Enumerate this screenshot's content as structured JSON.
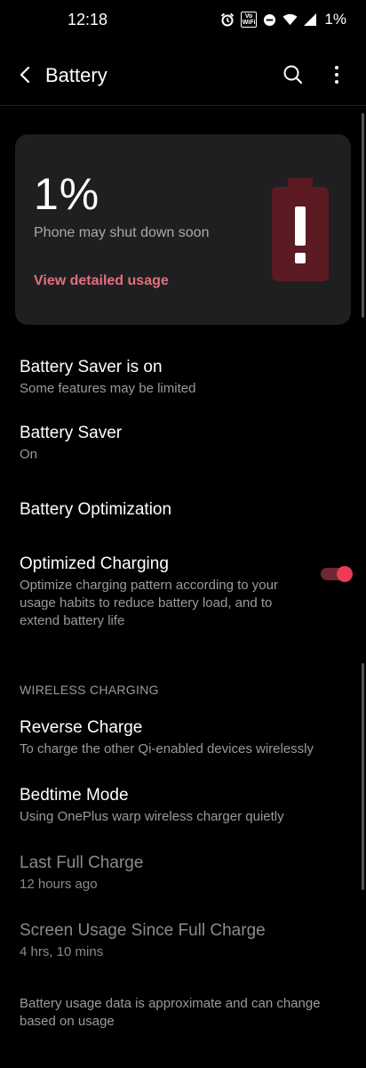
{
  "status_bar": {
    "time": "12:18",
    "volte_label": "Vo\nWiFi",
    "battery_percent": "1%",
    "icons": [
      "alarm-icon",
      "volte-wifi-icon",
      "dnd-icon",
      "wifi-icon",
      "signal-icon"
    ]
  },
  "app_bar": {
    "title": "Battery",
    "icons": [
      "back-arrow-icon",
      "search-icon",
      "more-vert-icon"
    ]
  },
  "battery_card": {
    "percent": "1%",
    "message": "Phone may shut down soon",
    "link": "View detailed usage",
    "icon": "battery-alert-icon"
  },
  "settings": [
    {
      "title": "Battery Saver is on",
      "subtitle": "Some features may be limited"
    },
    {
      "title": "Battery Saver",
      "subtitle": "On"
    },
    {
      "title": "Battery Optimization",
      "subtitle": ""
    },
    {
      "title": "Optimized Charging",
      "subtitle": "Optimize charging pattern according to your usage habits to reduce battery load, and to extend battery life",
      "toggle": true
    }
  ],
  "wireless_section": {
    "header": "WIRELESS CHARGING",
    "items": [
      {
        "title": "Reverse Charge",
        "subtitle": "To charge the other Qi-enabled devices wirelessly"
      },
      {
        "title": "Bedtime Mode",
        "subtitle": "Using OnePlus warp wireless charger quietly"
      }
    ]
  },
  "info_items": [
    {
      "title": "Last Full Charge",
      "subtitle": "12 hours ago"
    },
    {
      "title": "Screen Usage Since Full Charge",
      "subtitle": "4 hrs, 10 mins"
    }
  ],
  "footer": "Battery usage data is approximate and can change based on usage",
  "colors": {
    "background": "#000000",
    "card": "#1f1f21",
    "accent": "#e0707e",
    "toggle_thumb": "#eb3b55",
    "toggle_track": "#6e2735",
    "battery_icon": "#5c1a22"
  }
}
